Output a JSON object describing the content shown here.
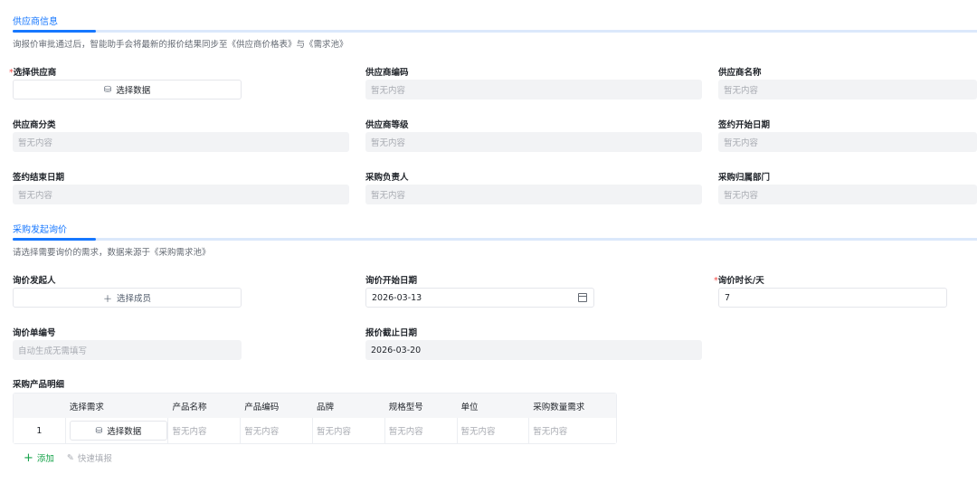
{
  "supplier_section": {
    "title": "供应商信息",
    "desc": "询报价审批通过后，智能助手会将最新的报价结果同步至《供应商价格表》与《需求池》",
    "select_supplier_label": "选择供应商",
    "select_data_btn": "选择数据",
    "fields": [
      {
        "label": "供应商编码",
        "value": "暂无内容"
      },
      {
        "label": "供应商名称",
        "value": "暂无内容"
      },
      {
        "label": "供应商分类",
        "value": "暂无内容"
      },
      {
        "label": "供应商等级",
        "value": "暂无内容"
      },
      {
        "label": "签约开始日期",
        "value": "暂无内容"
      },
      {
        "label": "签约结束日期",
        "value": "暂无内容"
      },
      {
        "label": "采购负责人",
        "value": "暂无内容"
      },
      {
        "label": "采购归属部门",
        "value": "暂无内容"
      }
    ]
  },
  "inquiry_section": {
    "title": "采购发起询价",
    "desc": "请选择需要询价的需求，数据来源于《采购需求池》",
    "initiator_label": "询价发起人",
    "select_member_btn": "选择成员",
    "start_date_label": "询价开始日期",
    "start_date_value": "2026-03-13",
    "duration_label": "询价时长/天",
    "duration_value": "7",
    "number_label": "询价单编号",
    "number_value": "自动生成无需填写",
    "deadline_label": "报价截止日期",
    "deadline_value": "2026-03-20"
  },
  "product_table": {
    "title": "采购产品明细",
    "headers": [
      "选择需求",
      "产品名称",
      "产品编码",
      "品牌",
      "规格型号",
      "单位",
      "采购数量需求"
    ],
    "rows": [
      {
        "index": "1",
        "select_btn": "选择数据",
        "cells": [
          "暂无内容",
          "暂无内容",
          "暂无内容",
          "暂无内容",
          "暂无内容",
          "暂无内容"
        ]
      }
    ],
    "add_label": "添加",
    "quick_fill_label": "快速填报"
  },
  "colors": {
    "accent": "#1677ff",
    "required": "#f54a45",
    "add": "#16a34a"
  },
  "icons": {
    "database": "database-icon",
    "plus": "plus-icon",
    "calendar": "calendar-icon",
    "quick-fill": "edit-icon"
  }
}
